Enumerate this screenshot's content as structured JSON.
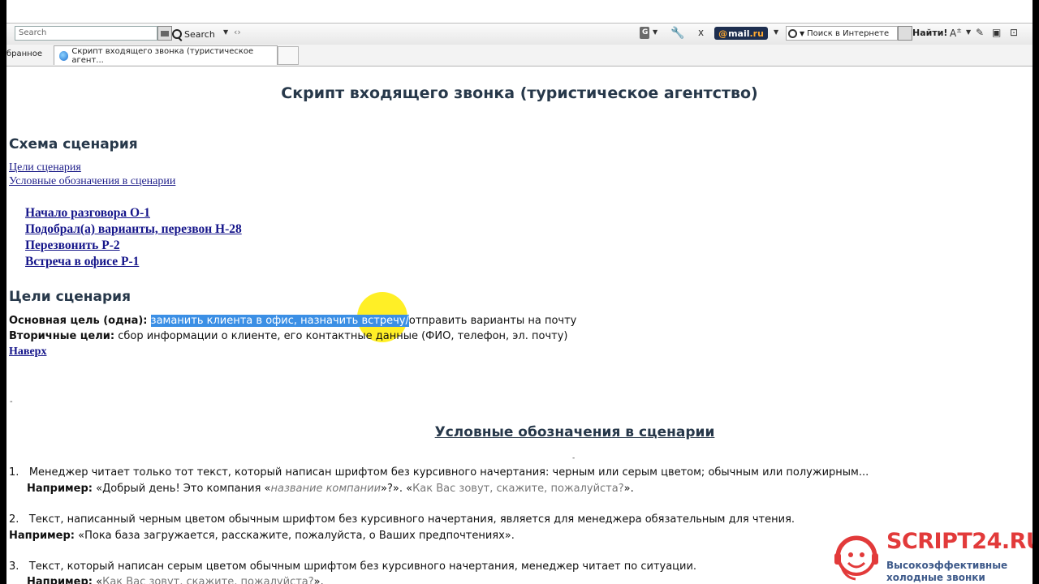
{
  "toolbar": {
    "search_placeholder": "Search",
    "search_button_label": "Search",
    "mail_brand_at": "@",
    "mail_brand_name": "mail",
    "mail_brand_ru": ".ru",
    "internet_search_label": "Поиск в Интернете",
    "find_label": "Найти!"
  },
  "tabs": {
    "favorites_label": "бранное",
    "active_tab_title": "Скрипт входящего звонка (туристическое агент..."
  },
  "document": {
    "title": "Скрипт входящего звонка (туристическое агентство)",
    "scheme_heading": "Схема сценария",
    "small_links": [
      "Цели сценария",
      "Условные обозначения в сценарии"
    ],
    "scenario_links": [
      "Начало разговора О-1",
      "Подобрал(а) варианты, перезвон Н-28",
      "Перезвонить Р-2",
      "Встреча в офисе Р-1"
    ],
    "goals_heading": "Цели сценария",
    "primary_goal_label": "Основная цель (одна):",
    "primary_goal_selected": "заманить клиента в офис, назначить встречу/",
    "primary_goal_rest": "отправить варианты на почту",
    "secondary_goal_label": "Вторичные цели:",
    "secondary_goal_text": "сбор информации о клиенте,  его контактные данные (ФИО, телефон, эл. почту)",
    "back_to_top": "Наверх",
    "legend_heading": "Условные обозначения в сценарии",
    "items": [
      {
        "number": "1.",
        "text": "Менеджер читает только тот текст, который написан шрифтом без курсивного начертания: черным или серым цветом; обычным или полужирным...",
        "example_label": "Например:",
        "example_a": " «Добрый день! Это компания «",
        "example_italic": "название компании",
        "example_b": "»?». «",
        "example_gray": "Как Вас зовут, скажите, пожалуйста?",
        "example_c": "»."
      },
      {
        "number": "2.",
        "text": "Текст,  написанный черным цветом обычным шрифтом без курсивного начертания, является для менеджера обязательным для чтения.",
        "example_label": "Например:",
        "example_a": " «Пока база загружается, расскажите, пожалуйста, о Ваших предпочтениях»."
      },
      {
        "number": "3.",
        "text": "Текст, который написан серым цветом обычным шрифтом без курсивного начертания, менеджер читает по ситуации.",
        "example_label": "Например:",
        "example_a": " «",
        "example_gray": "Как Вас зовут, скажите, пожалуйста?",
        "example_c": "»."
      }
    ]
  },
  "watermark": {
    "brand": "SCRIPT24.RU",
    "tagline1": "Высокоэффективные",
    "tagline2": "холодные звонки"
  }
}
